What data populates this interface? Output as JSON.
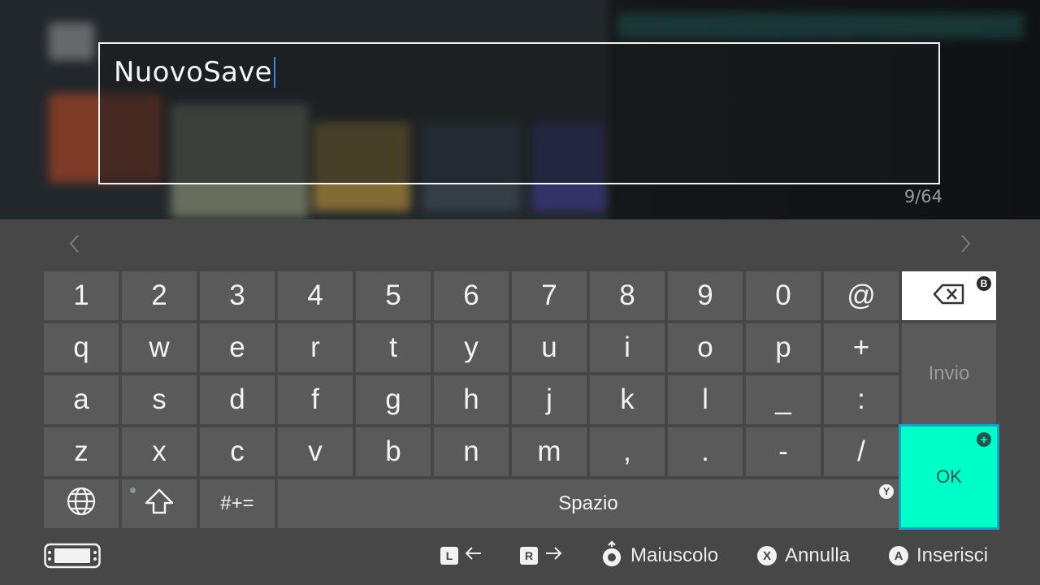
{
  "input": {
    "value": "NuovoSave",
    "count": "9/64"
  },
  "keyboard": {
    "rows": [
      [
        "1",
        "2",
        "3",
        "4",
        "5",
        "6",
        "7",
        "8",
        "9",
        "0",
        "@"
      ],
      [
        "q",
        "w",
        "e",
        "r",
        "t",
        "y",
        "u",
        "i",
        "o",
        "p",
        "+"
      ],
      [
        "a",
        "s",
        "d",
        "f",
        "g",
        "h",
        "j",
        "k",
        "l",
        "_",
        ":"
      ],
      [
        "z",
        "x",
        "c",
        "v",
        "b",
        "n",
        "m",
        ",",
        ".",
        "-",
        "/"
      ]
    ],
    "symbols_label": "#+=",
    "space_label": "Spazio",
    "enter_label": "Invio",
    "ok_label": "OK",
    "badges": {
      "backspace": "B",
      "ok": "+",
      "space": "Y"
    }
  },
  "footer": {
    "l_button": "L",
    "r_button": "R",
    "shift_label": "Maiuscolo",
    "x_button": "X",
    "cancel_label": "Annulla",
    "a_button": "A",
    "insert_label": "Inserisci"
  },
  "colors": {
    "accent": "#00ffc8",
    "focus_outline": "#19a3c3",
    "key_bg": "#5a5a5a",
    "panel_bg": "#474747"
  },
  "icons": [
    "chevron-left-icon",
    "chevron-right-icon",
    "backspace-icon",
    "globe-icon",
    "shift-icon",
    "console-icon",
    "stick-icon"
  ]
}
